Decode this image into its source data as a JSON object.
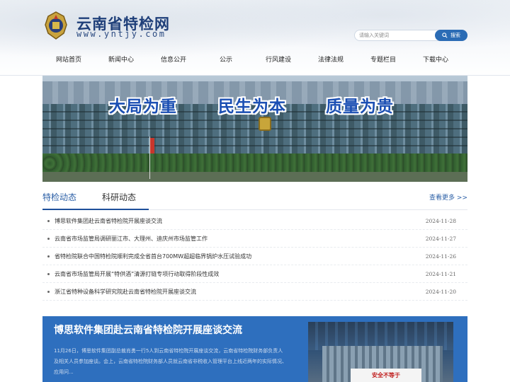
{
  "header": {
    "site_title": "云南省特检网",
    "site_url": "www.yntjy.com"
  },
  "search": {
    "placeholder": "请输入关键词",
    "button_label": "搜索"
  },
  "nav": {
    "items": [
      "网站首页",
      "新闻中心",
      "信息公开",
      "公示",
      "行风建设",
      "法律法规",
      "专题栏目",
      "下载中心"
    ]
  },
  "banner": {
    "slogans": [
      "大局为重",
      "民生为本",
      "质量为贵"
    ]
  },
  "tabs": {
    "items": [
      "特检动态",
      "科研动态"
    ],
    "active": 0,
    "more_label": "查看更多 >>"
  },
  "news": [
    {
      "title": "博思软件集团赴云南省特检院开展座谈交流",
      "date": "2024-11-28"
    },
    {
      "title": "云南省市场监管局调研丽江市、大理州、迪庆州市场监管工作",
      "date": "2024-11-27"
    },
    {
      "title": "省特检院联合中国特检院顺利完成全省首台700MW超超临界锅炉水压试验成功",
      "date": "2024-11-26"
    },
    {
      "title": "云南省市场监管局开展“特供酒”清源打链专项行动取得阶段性成效",
      "date": "2024-11-21"
    },
    {
      "title": "浙江省特种设备科学研究院赴云南省特检院开展座谈交流",
      "date": "2024-11-20"
    }
  ],
  "feature": {
    "title": "博思软件集团赴云南省特检院开展座谈交流",
    "summary": "11月26日，博思软件集团副总裁肖勇一行5人到云南省特检院开展座谈交流，云南省特检院财务部负责人及相关人员参加座谈。会上，云南省特检院财务部人员就云南省非税收入管理平台上线近两年的实际情况、应用问...",
    "image_sign": "安全不等于"
  },
  "colors": {
    "brand_blue": "#1f3f79",
    "accent_blue": "#2b6cb5",
    "feature_bg": "#2e6fbe"
  }
}
